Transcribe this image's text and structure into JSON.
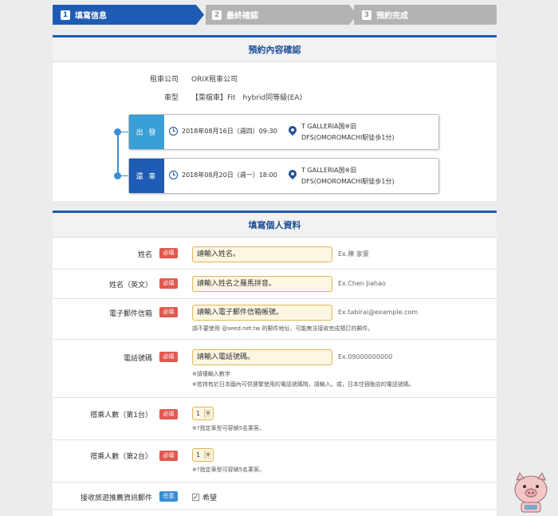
{
  "steps": [
    {
      "num": "1",
      "label": "填寫信息"
    },
    {
      "num": "2",
      "label": "最終確認"
    },
    {
      "num": "3",
      "label": "預約完成"
    }
  ],
  "confirm": {
    "title": "預約內容確認",
    "company_label": "租車公司",
    "company_value": "ORIX租車公司",
    "car_label": "車型",
    "car_value": "【菜檔車】Fit　hybrid同等級(EA)",
    "pickup": {
      "tag": "出 發",
      "time": "2018年08月16日（週四）09:30",
      "loc_line1": "T GALLERIA国※旧",
      "loc_line2": "DFS(OMOROMACHI駅徒歩1分)"
    },
    "return": {
      "tag": "還 車",
      "time": "2018年08月20日（週一）18:00",
      "loc_line1": "T GALLERIA国※旧",
      "loc_line2": "DFS(OMOROMACHI駅徒歩1分)"
    }
  },
  "form": {
    "title": "填寫個人資料",
    "required_badge": "必填",
    "optional_badge": "任意",
    "name": {
      "label": "姓名",
      "placeholder": "請輸入姓名。",
      "example": "Ex.陳 家豪"
    },
    "name_en": {
      "label": "姓名（英文）",
      "placeholder": "請輸入姓名之羅馬拼音。",
      "example": "Ex.Chen Jiahao"
    },
    "email": {
      "label": "電子郵件信箱",
      "placeholder": "請輸入電子郵件信箱帳號。",
      "example": "Ex.tabirai@example.com",
      "note": "請不要使用 @seed.net.tw 的郵件地址，可能無法接收完成預訂的郵件。"
    },
    "phone": {
      "label": "電話號碼",
      "placeholder": "請輸入電話號碼。",
      "example": "Ex.09000000000",
      "note1": "※請僅輸入數字",
      "note2": "※若持有於日本國內可供連繫使用的電話號碼時，請輸入。或，日本住宿飯店的電話號碼。"
    },
    "passengers1": {
      "label": "搭乘人數（第1台）",
      "value": "1",
      "note": "※?指定車型可容納5名乘客。"
    },
    "passengers2": {
      "label": "搭乘人數（第2台）",
      "value": "1",
      "note": "※?指定車型可容納5名乘客。"
    },
    "newsletter": {
      "label": "接收旅遊推薦資訊郵件",
      "option": "希望"
    }
  },
  "colors": {
    "primary": "#1d5bb5",
    "step_inactive": "#b3b3b3",
    "required": "#e05a4f",
    "optional": "#3a8ed6",
    "input_bg": "#fdf6e3",
    "input_border": "#e3b556"
  },
  "icons": {
    "clock": "clock-icon",
    "pin": "location-pin-icon",
    "check": "checkbox-check-icon"
  }
}
